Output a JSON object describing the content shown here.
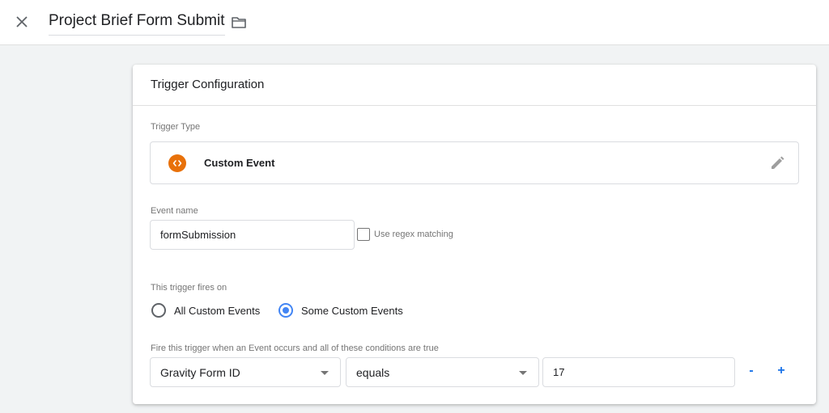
{
  "header": {
    "title": "Project Brief Form Submit",
    "close_icon": "close-icon",
    "folder_icon": "folder-icon"
  },
  "card": {
    "title": "Trigger Configuration",
    "trigger_type": {
      "label": "Trigger Type",
      "value": "Custom Event",
      "icon": "custom-event-icon",
      "icon_color": "#e8710a",
      "edit_icon": "pencil-icon"
    },
    "event_name": {
      "label": "Event name",
      "value": "formSubmission",
      "regex_label": "Use regex matching",
      "regex_checked": false
    },
    "fires_on": {
      "label": "This trigger fires on",
      "options": [
        {
          "label": "All Custom Events",
          "checked": false
        },
        {
          "label": "Some Custom Events",
          "checked": true
        }
      ]
    },
    "conditions": {
      "label": "Fire this trigger when an Event occurs and all of these conditions are true",
      "rows": [
        {
          "variable": "Gravity Form ID",
          "operator": "equals",
          "value": "17"
        }
      ],
      "remove_label": "-",
      "add_label": "+"
    }
  },
  "colors": {
    "accent": "#4285f4",
    "link_blue": "#1a73e8",
    "custom_event_orange": "#e8710a"
  }
}
